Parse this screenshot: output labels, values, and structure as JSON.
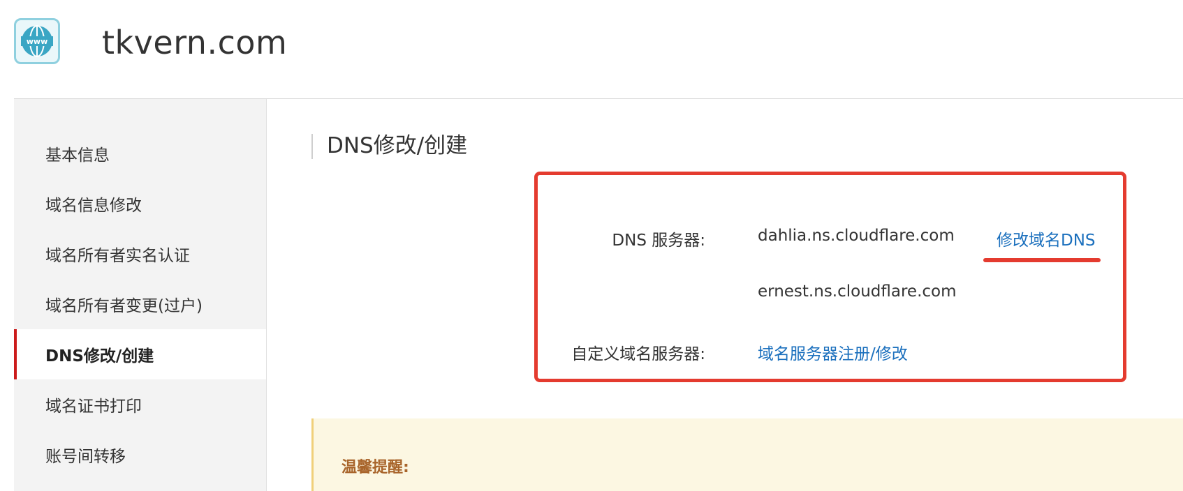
{
  "header": {
    "domain_title": "tkvern.com",
    "logo_icon": "www-globe-icon",
    "logo_text": "www"
  },
  "sidebar": {
    "items": [
      {
        "label": "基本信息",
        "active": false
      },
      {
        "label": "域名信息修改",
        "active": false
      },
      {
        "label": "域名所有者实名认证",
        "active": false
      },
      {
        "label": "域名所有者变更(过户)",
        "active": false
      },
      {
        "label": "DNS修改/创建",
        "active": true
      },
      {
        "label": "域名证书打印",
        "active": false
      },
      {
        "label": "账号间转移",
        "active": false
      }
    ]
  },
  "main": {
    "section_title": "DNS修改/创建",
    "dns_servers_label": "DNS 服务器:",
    "dns_servers": [
      "dahlia.ns.cloudflare.com",
      "ernest.ns.cloudflare.com"
    ],
    "modify_dns_link": "修改域名DNS",
    "custom_ns_label": "自定义域名服务器:",
    "custom_ns_link": "域名服务器注册/修改"
  },
  "notice": {
    "title": "温馨提醒:"
  },
  "colors": {
    "accent_red": "#e43b2f",
    "link_blue": "#1a6fbd",
    "active_marker": "#cc1b1b",
    "notice_title": "#a8642a"
  }
}
